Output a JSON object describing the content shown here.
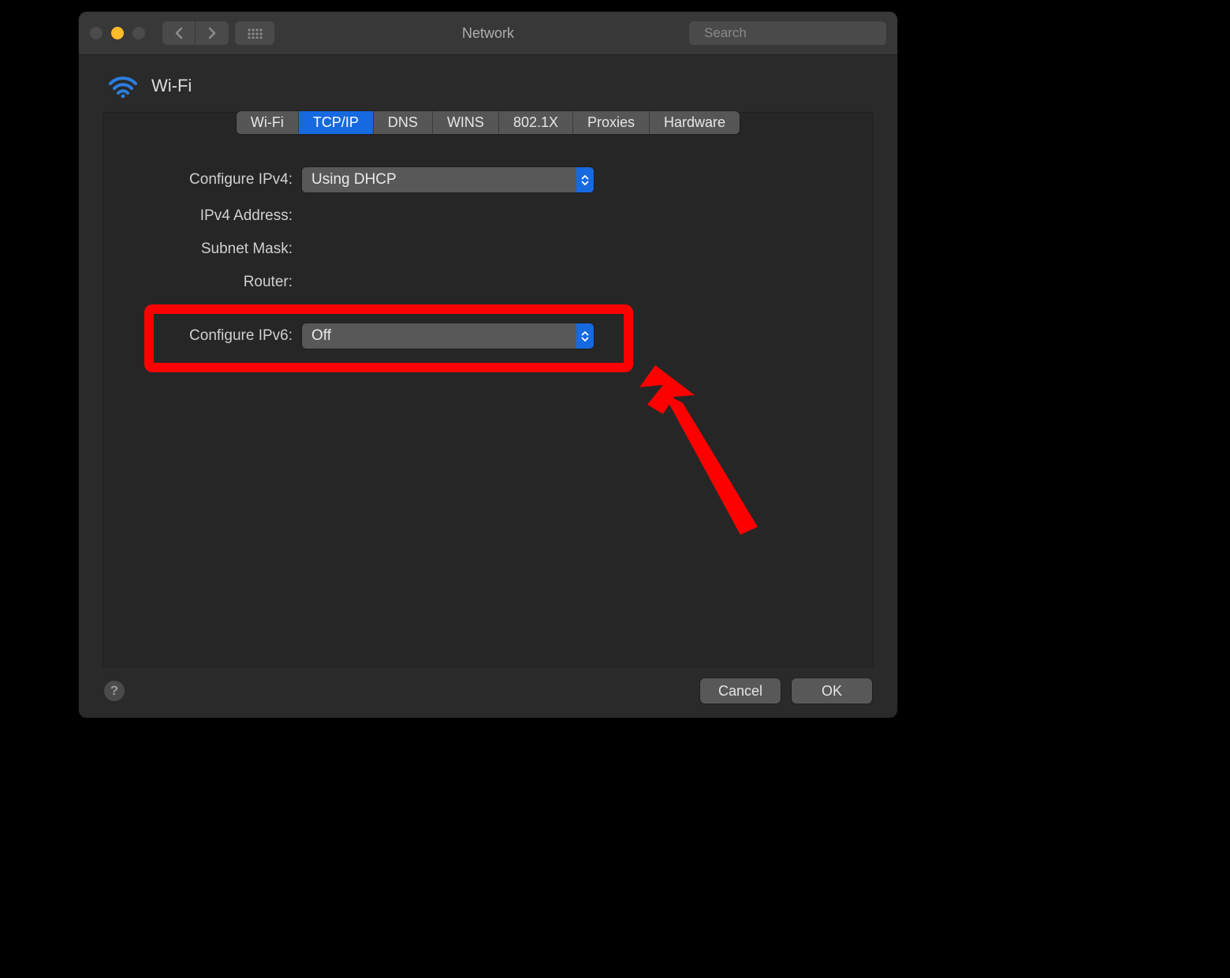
{
  "window": {
    "title": "Network"
  },
  "search": {
    "placeholder": "Search"
  },
  "header": {
    "title": "Wi-Fi"
  },
  "tabs": [
    {
      "label": "Wi-Fi",
      "active": false
    },
    {
      "label": "TCP/IP",
      "active": true
    },
    {
      "label": "DNS",
      "active": false
    },
    {
      "label": "WINS",
      "active": false
    },
    {
      "label": "802.1X",
      "active": false
    },
    {
      "label": "Proxies",
      "active": false
    },
    {
      "label": "Hardware",
      "active": false
    }
  ],
  "form": {
    "configure_ipv4_label": "Configure IPv4:",
    "configure_ipv4_value": "Using DHCP",
    "ipv4_address_label": "IPv4 Address:",
    "ipv4_address_value": "",
    "subnet_mask_label": "Subnet Mask:",
    "subnet_mask_value": "",
    "router_label": "Router:",
    "router_value": "",
    "configure_ipv6_label": "Configure IPv6:",
    "configure_ipv6_value": "Off"
  },
  "footer": {
    "cancel": "Cancel",
    "ok": "OK",
    "help": "?"
  },
  "annotation": {
    "highlight": "configure-ipv6-row",
    "arrow_color": "#ff0000"
  }
}
